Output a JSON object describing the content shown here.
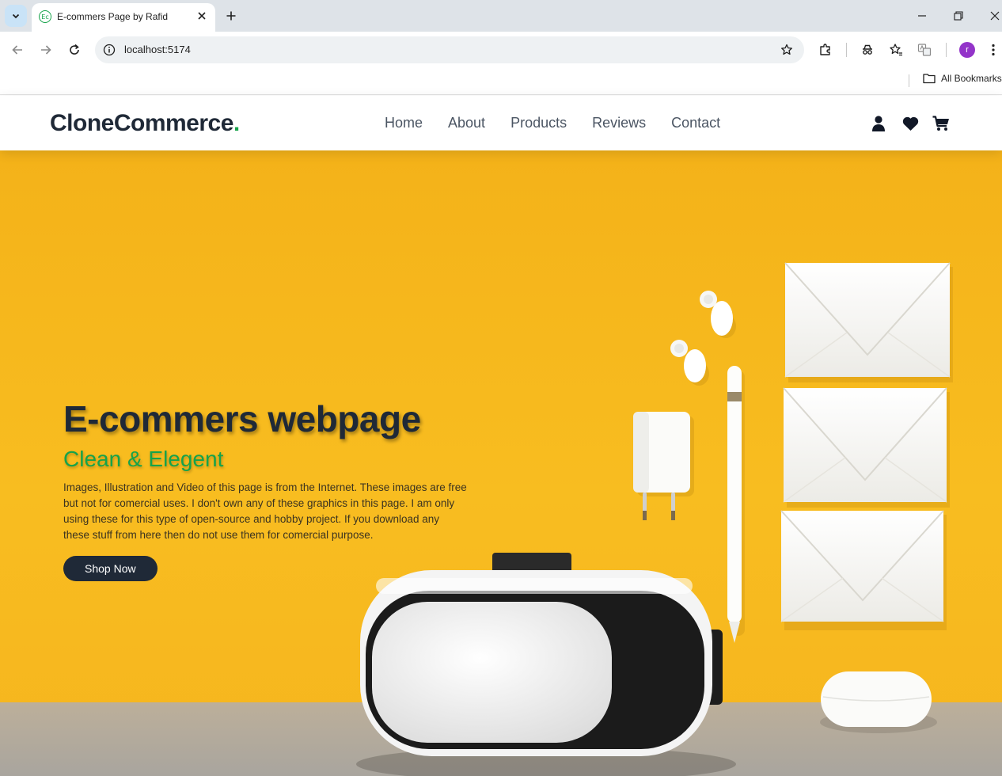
{
  "browser": {
    "tab_title": "E-commers Page by Rafid",
    "favicon_text": "Ec",
    "url": "localhost:5174",
    "bookmarks_label": "All Bookmarks",
    "profile_initial": "r"
  },
  "site": {
    "logo": "CloneCommerce",
    "logo_dot": ".",
    "menu": [
      "Home",
      "About",
      "Products",
      "Reviews",
      "Contact"
    ],
    "icons": [
      "user-icon",
      "heart-icon",
      "cart-icon"
    ]
  },
  "hero": {
    "title": "E-commers webpage",
    "subtitle": "Clean & Elegent",
    "description": "Images, Illustration and Video of this page is from the Internet. These images are free but not for comercial uses. I don't own any of these graphics in this page. I am only using these for this type of open-source and hobby project. If you download any these stuff from here then do not use them for comercial purpose.",
    "button": "Shop Now"
  },
  "colors": {
    "brand_dark": "#1f2937",
    "accent_green": "#16a34a",
    "hero_yellow": "#f8bd20"
  }
}
